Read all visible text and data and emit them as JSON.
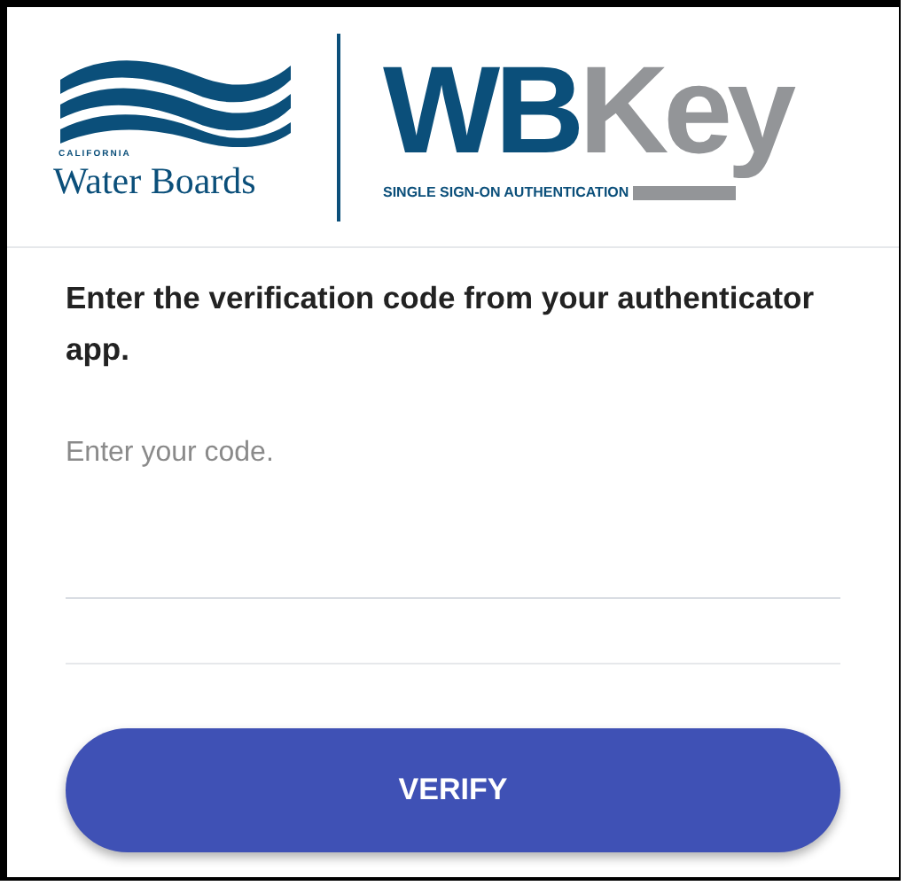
{
  "logo": {
    "state": "CALIFORNIA",
    "agency": "Water Boards",
    "brand_primary": "WB",
    "brand_secondary": "Key",
    "tagline": "SINGLE SIGN-ON AUTHENTICATION"
  },
  "prompt": "Enter the verification code from your authenticator app.",
  "code_field": {
    "placeholder": "Enter your code."
  },
  "buttons": [
    "VERIFY"
  ]
}
